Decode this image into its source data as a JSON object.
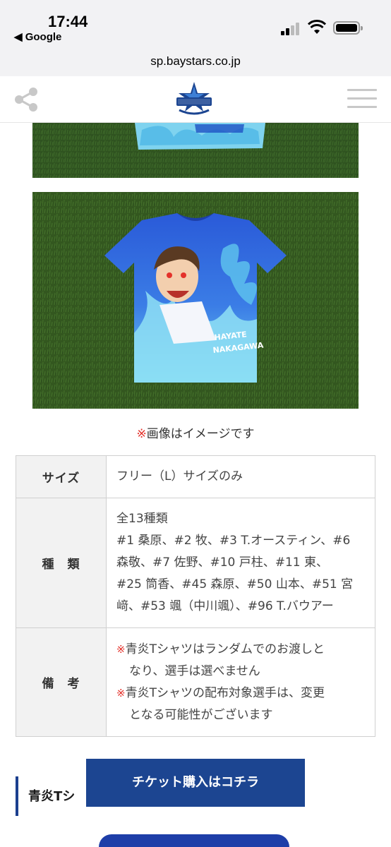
{
  "status_bar": {
    "time": "17:44",
    "back_label": "◀ Google"
  },
  "url_bar": {
    "domain": "sp.baystars.co.jp"
  },
  "header": {
    "share_icon": "share-icon",
    "logo_icon": "baystars-star-logo",
    "menu_icon": "hamburger-menu-icon"
  },
  "colors": {
    "brand_blue": "#1c4591",
    "accent_red": "#e4322b",
    "table_header_bg": "#f2f2f2"
  },
  "caption": {
    "mark": "※",
    "text": "画像はイメージです"
  },
  "table": {
    "size": {
      "label": "サイズ",
      "value": "フリー（L）サイズのみ"
    },
    "type": {
      "label": "種　類",
      "lines": [
        "全13種類",
        "#1 桑原、#2 牧、#3 T.オースティン、#6",
        "森敬、#7 佐野、#10 戸柱、#11 東、",
        "#25 筒香、#45 森原、#50 山本、#51 宮",
        "﨑、#53 颯（中川颯）、#96 T.バウアー"
      ]
    },
    "note": {
      "label": "備　考",
      "mark": "※",
      "items": [
        {
          "line1": "青炎Tシャツはランダムでのお渡しと",
          "line2": "なり、選手は選べません"
        },
        {
          "line1": "青炎Tシャツの配布対象選手は、変更",
          "line2": "となる可能性がございます"
        }
      ]
    }
  },
  "section": {
    "title": "青炎Tシ"
  },
  "ticket_button": {
    "label": "チケット購入はコチラ"
  }
}
